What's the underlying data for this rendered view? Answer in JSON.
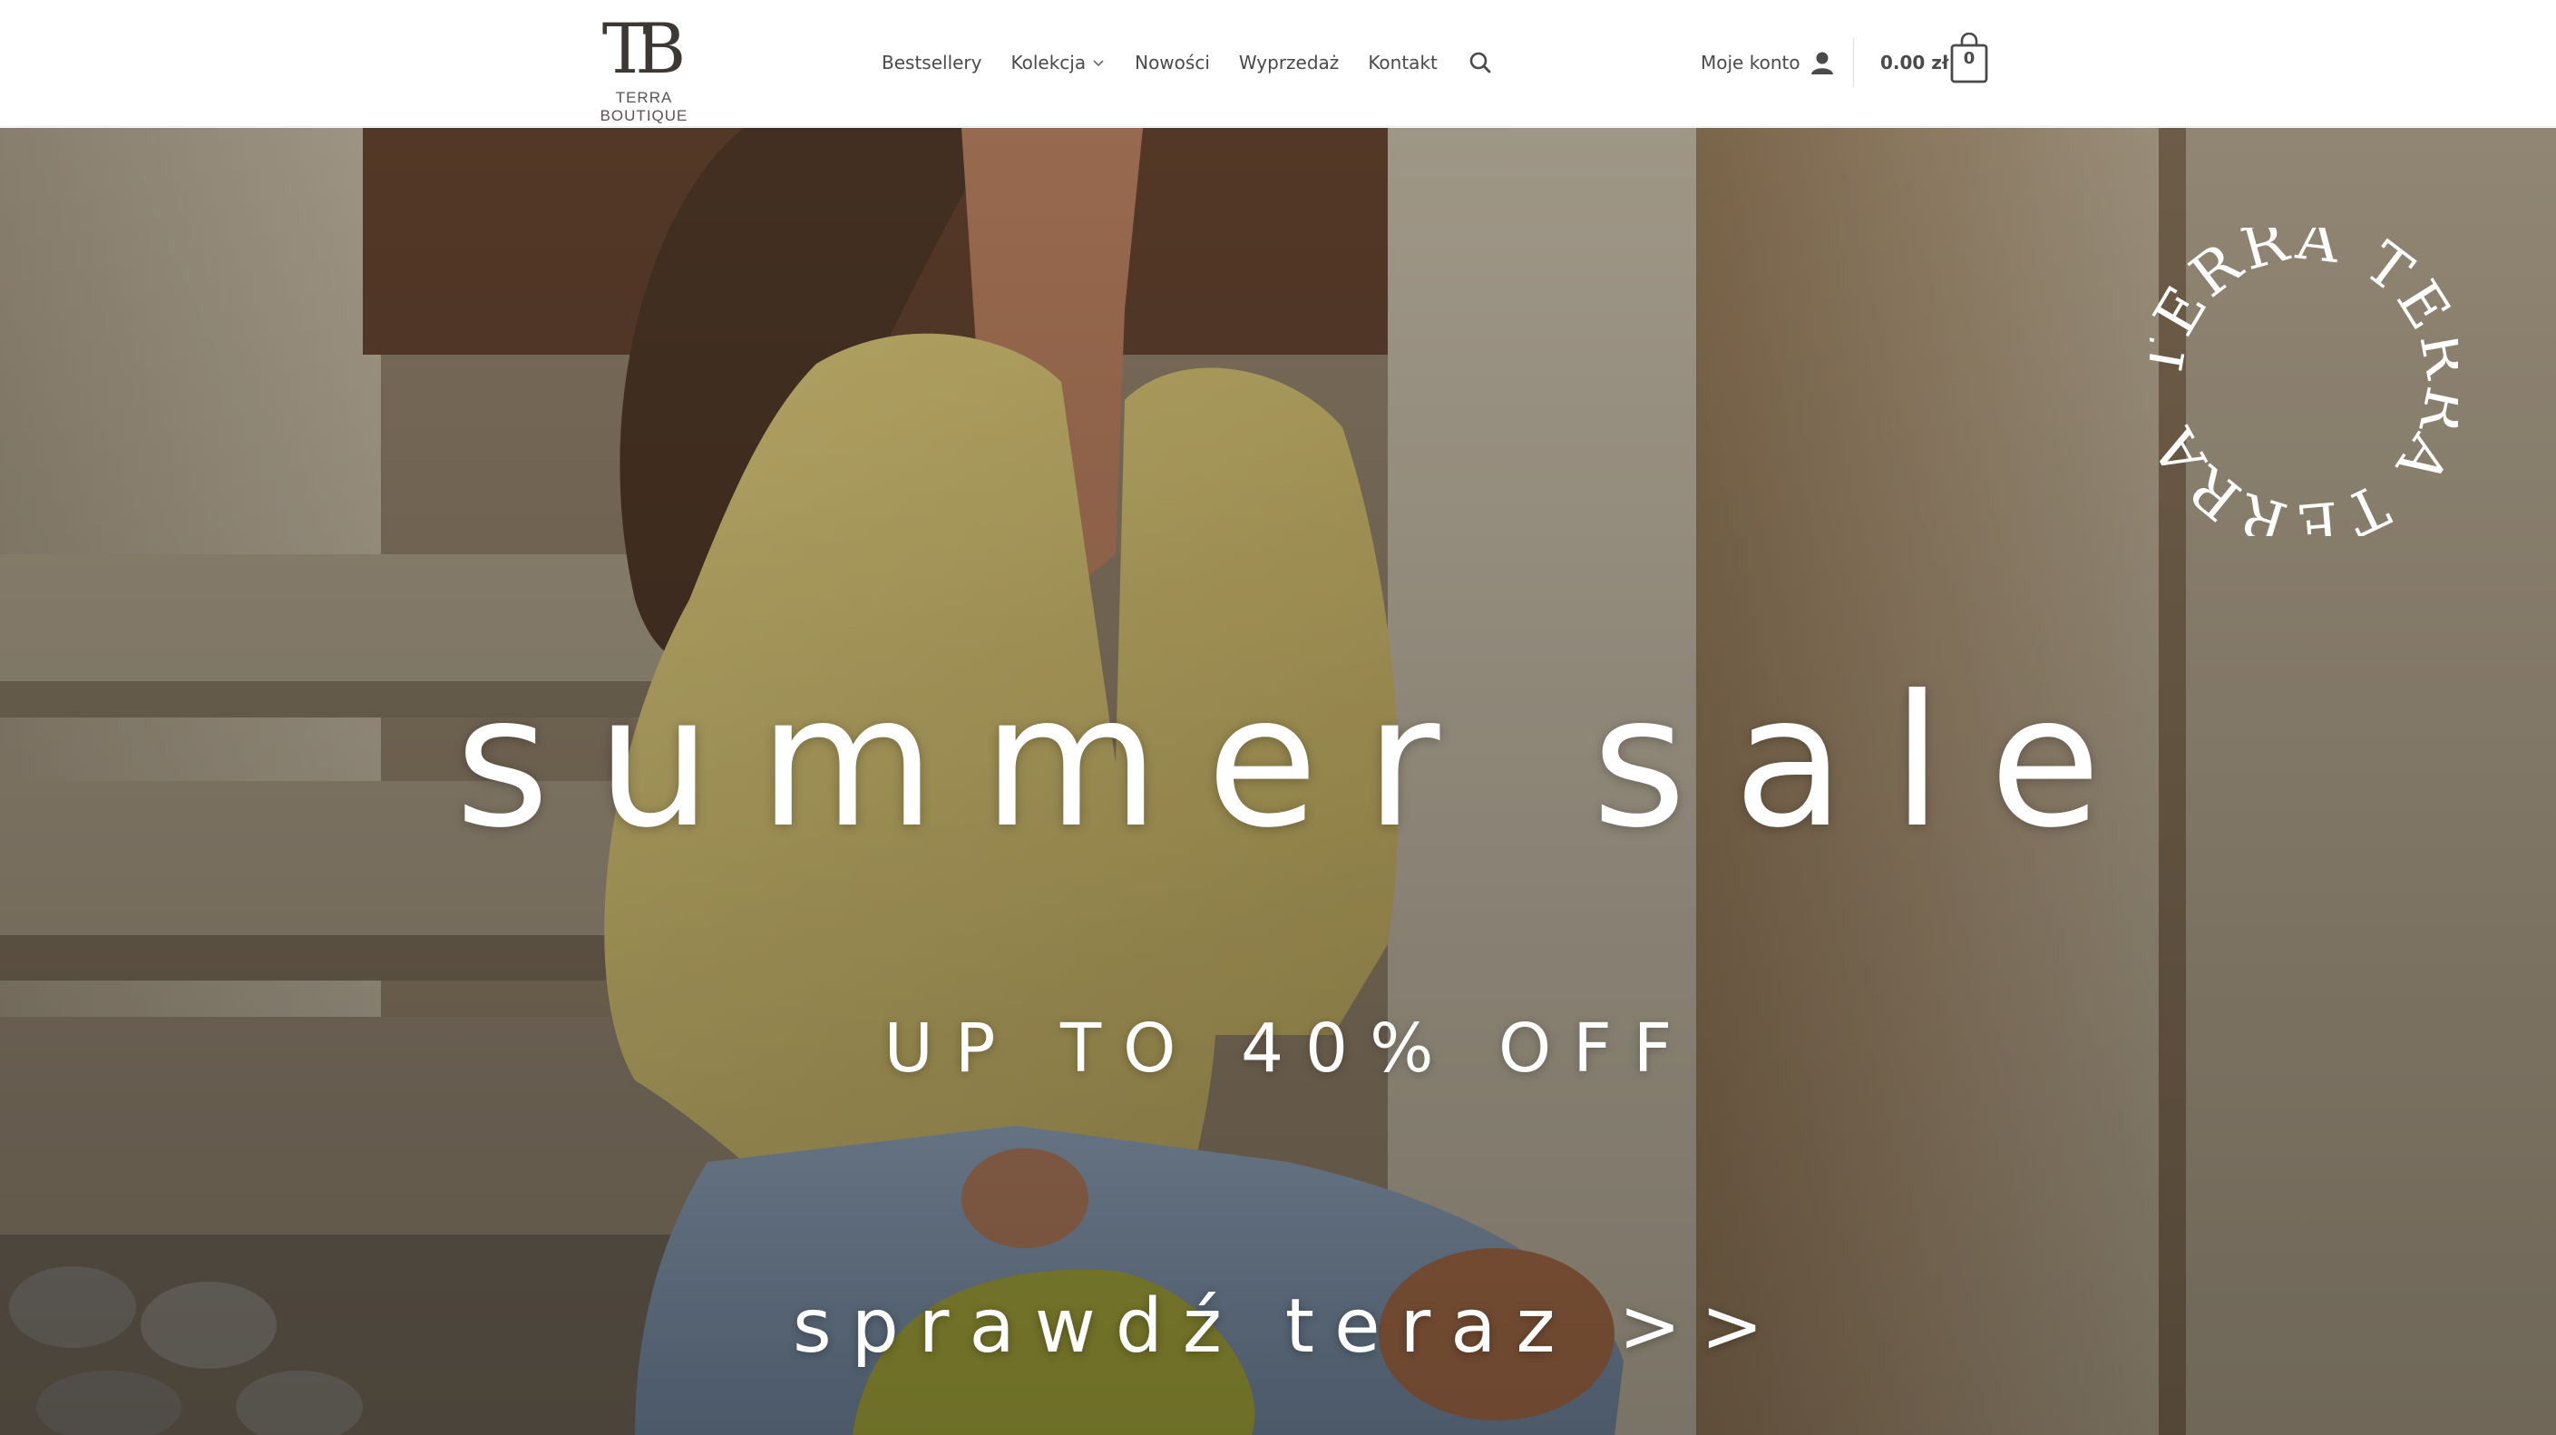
{
  "brand": {
    "logo_mark": "TB",
    "logo_text": "TERRA BOUTIQUE"
  },
  "nav": {
    "items": [
      {
        "label": "Bestsellery"
      },
      {
        "label": "Kolekcja"
      },
      {
        "label": "Nowości"
      },
      {
        "label": "Wyprzedaż"
      },
      {
        "label": "Kontakt"
      }
    ],
    "search_icon": "search-icon",
    "dropdown_icon": "chevron-down-icon"
  },
  "account": {
    "label": "Moje konto",
    "icon": "user-icon"
  },
  "cart": {
    "total": "0.00 zł",
    "count": "0",
    "icon": "shopping-bag-icon"
  },
  "hero": {
    "title": "summer sale",
    "subtitle": "UP TO 40% OFF",
    "cta": "sprawdź teraz >>",
    "badge_text": "TERRA TERRA TERRA"
  },
  "colors": {
    "text_dark": "#4a4a4a",
    "hero_text": "#ffffff",
    "header_bg": "#ffffff"
  }
}
